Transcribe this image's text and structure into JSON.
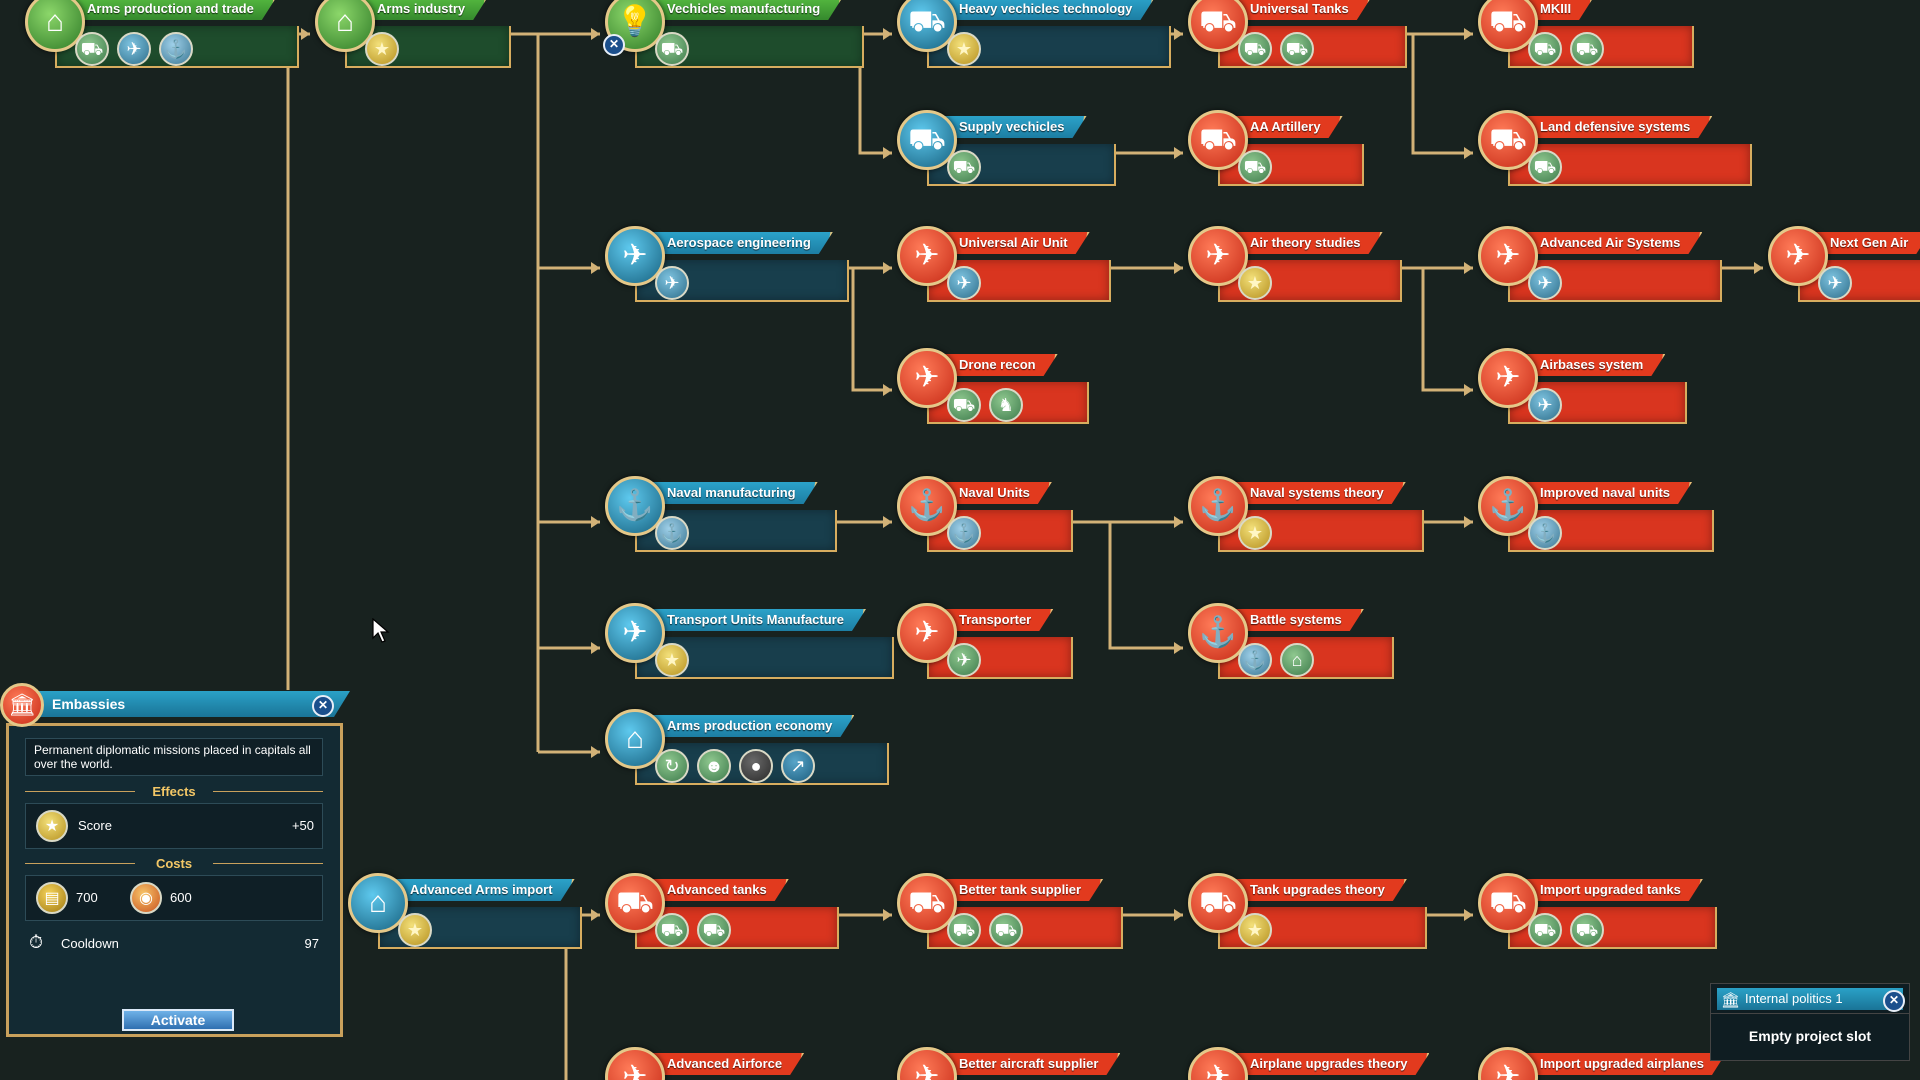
{
  "colors": {
    "background": "#18221f",
    "connector": "#d2b277",
    "red_node": "#d9351f",
    "blue_node": "#183e4c",
    "green_node": "#1e4c2c",
    "panel_border": "#c9a15c"
  },
  "nodes": [
    {
      "id": "arms-production-and-trade",
      "label": "Arms production and trade",
      "theme": "green",
      "icon": "factory-icon",
      "effects": [
        "tank-icon",
        "plane-icon",
        "ship-icon"
      ]
    },
    {
      "id": "arms-industry",
      "label": "Arms industry",
      "theme": "green",
      "icon": "factory-icon",
      "effects": [
        "score-icon"
      ]
    },
    {
      "id": "vehicles-manufacturing",
      "label": "Vechicles manufacturing",
      "theme": "green",
      "icon": "lightbulb-icon",
      "effects": [
        "tank-icon"
      ]
    },
    {
      "id": "heavy-vehicles-technology",
      "label": "Heavy vechicles technology",
      "theme": "blue",
      "icon": "tank-icon",
      "effects": [
        "score-icon"
      ]
    },
    {
      "id": "universal-tanks",
      "label": "Universal Tanks",
      "theme": "red",
      "icon": "tank-icon",
      "effects": [
        "tank-icon",
        "tank-icon"
      ]
    },
    {
      "id": "mkiii",
      "label": "MKIII",
      "theme": "red",
      "icon": "tank-icon",
      "effects": [
        "tank-icon",
        "tank-icon"
      ]
    },
    {
      "id": "supply-vehicles",
      "label": "Supply vechicles",
      "theme": "blue",
      "icon": "tank-icon",
      "effects": [
        "tank-icon"
      ]
    },
    {
      "id": "aa-artillery",
      "label": "AA Artillery",
      "theme": "red",
      "icon": "tank-icon",
      "effects": [
        "tank-icon"
      ]
    },
    {
      "id": "land-defensive-systems",
      "label": "Land defensive systems",
      "theme": "red",
      "icon": "tank-icon",
      "effects": [
        "tank-icon"
      ]
    },
    {
      "id": "aerospace-engineering",
      "label": "Aerospace engineering",
      "theme": "blue",
      "icon": "jet-icon",
      "effects": [
        "plane-icon"
      ]
    },
    {
      "id": "universal-air-unit",
      "label": "Universal Air Unit",
      "theme": "red",
      "icon": "jet-icon",
      "effects": [
        "plane-icon"
      ]
    },
    {
      "id": "air-theory-studies",
      "label": "Air theory studies",
      "theme": "red",
      "icon": "jet-icon",
      "effects": [
        "score-icon"
      ]
    },
    {
      "id": "advanced-air-systems",
      "label": "Advanced Air Systems",
      "theme": "red",
      "icon": "jet-icon",
      "effects": [
        "plane-icon"
      ]
    },
    {
      "id": "next-gen-air",
      "label": "Next Gen Air",
      "theme": "red",
      "icon": "jet-icon",
      "effects": [
        "plane-icon"
      ]
    },
    {
      "id": "drone-recon",
      "label": "Drone recon",
      "theme": "red",
      "icon": "drone-icon",
      "effects": [
        "tank-icon",
        "soldier-icon"
      ]
    },
    {
      "id": "airbases-system",
      "label": "Airbases system",
      "theme": "red",
      "icon": "jet-icon",
      "effects": [
        "plane-icon"
      ]
    },
    {
      "id": "naval-manufacturing",
      "label": "Naval manufacturing",
      "theme": "blue",
      "icon": "ship-icon",
      "effects": [
        "ship-icon"
      ]
    },
    {
      "id": "naval-units",
      "label": "Naval Units",
      "theme": "red",
      "icon": "ship-icon",
      "effects": [
        "ship-icon"
      ]
    },
    {
      "id": "naval-systems-theory",
      "label": "Naval systems theory",
      "theme": "red",
      "icon": "ship-icon",
      "effects": [
        "score-icon"
      ]
    },
    {
      "id": "improved-naval-units",
      "label": "Improved naval units",
      "theme": "red",
      "icon": "ship-icon",
      "effects": [
        "ship-icon"
      ]
    },
    {
      "id": "transport-units-manufacture",
      "label": "Transport Units Manufacture",
      "theme": "blue",
      "icon": "transport-icon",
      "effects": [
        "score-icon"
      ]
    },
    {
      "id": "transporter",
      "label": "Transporter",
      "theme": "red",
      "icon": "transport-icon",
      "effects": [
        "transport-icon"
      ]
    },
    {
      "id": "battle-systems",
      "label": "Battle systems",
      "theme": "red",
      "icon": "ship-icon",
      "effects": [
        "ship-icon",
        "fort-icon"
      ]
    },
    {
      "id": "arms-production-economy",
      "label": "Arms production economy",
      "theme": "blue",
      "icon": "factory-icon",
      "effects": [
        "refresh-icon",
        "worker-icon",
        "piggy-icon",
        "chart-icon"
      ]
    },
    {
      "id": "advanced-arms-import",
      "label": "Advanced Arms import",
      "theme": "blue",
      "icon": "factory-icon",
      "effects": [
        "score-icon"
      ]
    },
    {
      "id": "advanced-tanks",
      "label": "Advanced tanks",
      "theme": "red",
      "icon": "tank-icon",
      "effects": [
        "tank-icon",
        "tank-icon"
      ]
    },
    {
      "id": "better-tank-supplier",
      "label": "Better tank supplier",
      "theme": "red",
      "icon": "tank-icon",
      "effects": [
        "tank-icon",
        "tank-icon"
      ]
    },
    {
      "id": "tank-upgrades-theory",
      "label": "Tank upgrades theory",
      "theme": "red",
      "icon": "tank-icon",
      "effects": [
        "score-icon"
      ]
    },
    {
      "id": "import-upgraded-tanks",
      "label": "Import upgraded tanks",
      "theme": "red",
      "icon": "tank-icon",
      "effects": [
        "tank-icon",
        "tank-icon"
      ]
    },
    {
      "id": "advanced-airforce",
      "label": "Advanced Airforce",
      "theme": "red",
      "icon": "jet-icon",
      "effects": []
    },
    {
      "id": "better-aircraft-supplier",
      "label": "Better aircraft supplier",
      "theme": "red",
      "icon": "jet-icon",
      "effects": []
    },
    {
      "id": "airplane-upgrades-theory",
      "label": "Airplane upgrades theory",
      "theme": "red",
      "icon": "jet-icon",
      "effects": []
    },
    {
      "id": "import-upgraded-airplanes",
      "label": "Import upgraded airplanes",
      "theme": "red",
      "icon": "jet-icon",
      "effects": []
    }
  ],
  "embassies_panel": {
    "title": "Embassies",
    "description": "Permanent diplomatic missions placed in capitals all over the world.",
    "effects_heading": "Effects",
    "effect_name": "Score",
    "effect_value": "+50",
    "costs_heading": "Costs",
    "cost_gold": "700",
    "cost_resource": "600",
    "cooldown_label": "Cooldown",
    "cooldown_value": "97",
    "activate_label": "Activate"
  },
  "project_panel": {
    "title": "Internal politics 1",
    "slot_text": "Empty project slot"
  }
}
